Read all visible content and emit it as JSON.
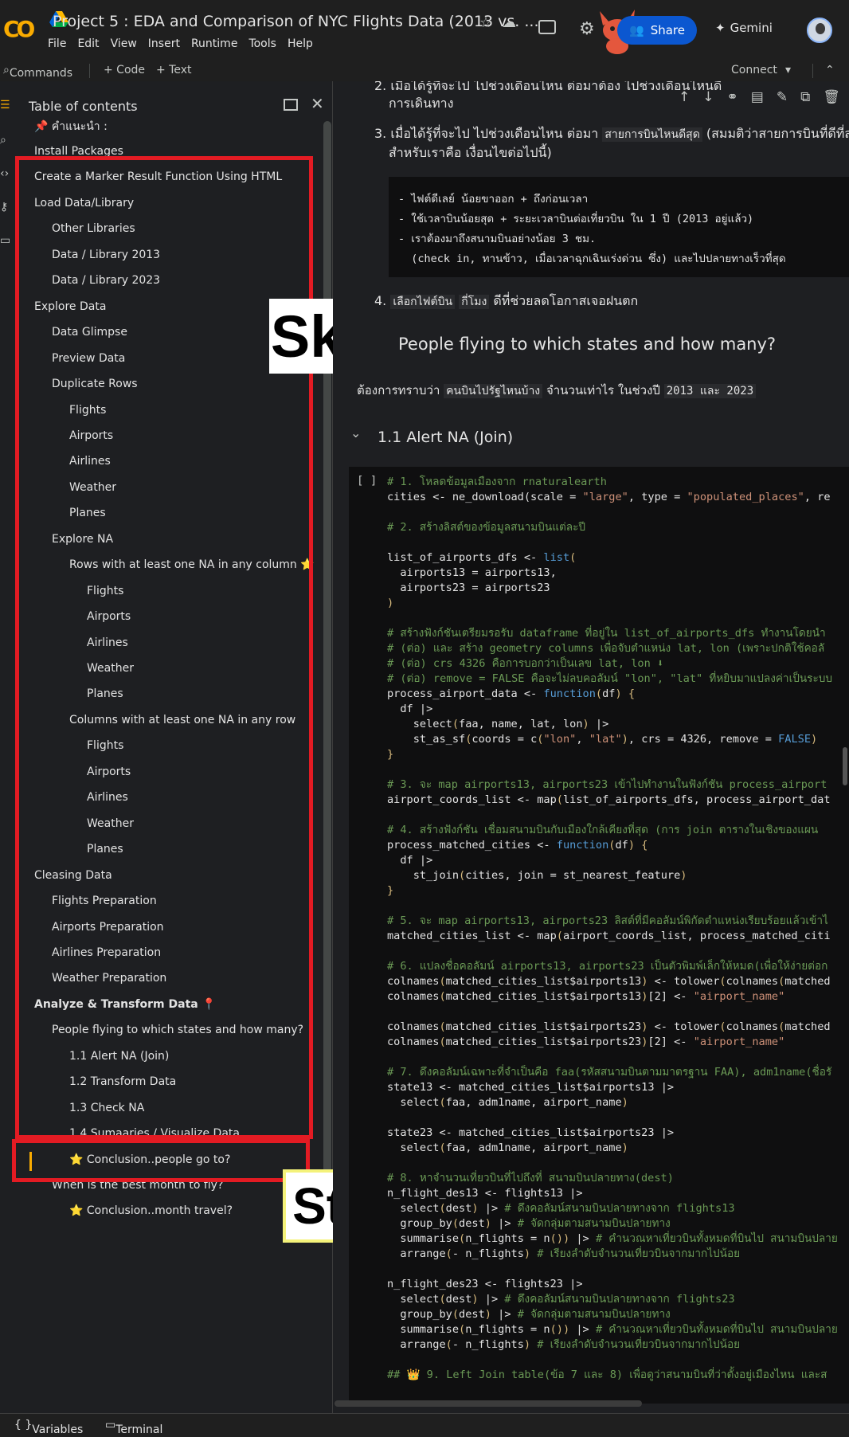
{
  "header": {
    "logo": "CO",
    "title": "Project 5 : EDA and Comparison of NYC Flights Data (2013 vs. ...",
    "menu": [
      "File",
      "Edit",
      "View",
      "Insert",
      "Runtime",
      "Tools",
      "Help"
    ],
    "share_label": "Share",
    "gemini_label": "Gemini"
  },
  "toolbar": {
    "commands_label": "Commands",
    "code_label": "+ Code",
    "text_label": "+ Text",
    "connect_label": "Connect"
  },
  "toc": {
    "title": "Table of contents",
    "note": "📌 คำแนะนำ :",
    "items": [
      {
        "label": "Install Packages",
        "level": 1
      },
      {
        "label": "Create a Marker Result Function Using HTML",
        "level": 1
      },
      {
        "label": "Load Data/Library",
        "level": 1
      },
      {
        "label": "Other Libraries",
        "level": 2
      },
      {
        "label": "Data / Library 2013",
        "level": 2
      },
      {
        "label": "Data / Library 2023",
        "level": 2
      },
      {
        "label": "Explore Data",
        "level": 1
      },
      {
        "label": "Data Glimpse",
        "level": 2
      },
      {
        "label": "Preview Data",
        "level": 2
      },
      {
        "label": "Duplicate Rows",
        "level": 2
      },
      {
        "label": "Flights",
        "level": 3
      },
      {
        "label": "Airports",
        "level": 3
      },
      {
        "label": "Airlines",
        "level": 3
      },
      {
        "label": "Weather",
        "level": 3
      },
      {
        "label": "Planes",
        "level": 3
      },
      {
        "label": "Explore NA",
        "level": 2
      },
      {
        "label": "Rows with at least one NA in any column ⭐",
        "level": 3
      },
      {
        "label": "Flights",
        "level": 4
      },
      {
        "label": "Airports",
        "level": 4
      },
      {
        "label": "Airlines",
        "level": 4
      },
      {
        "label": "Weather",
        "level": 4
      },
      {
        "label": "Planes",
        "level": 4
      },
      {
        "label": "Columns with at least one NA in any row",
        "level": 3
      },
      {
        "label": "Flights",
        "level": 4
      },
      {
        "label": "Airports",
        "level": 4
      },
      {
        "label": "Airlines",
        "level": 4
      },
      {
        "label": "Weather",
        "level": 4
      },
      {
        "label": "Planes",
        "level": 4
      },
      {
        "label": "Cleasing Data",
        "level": 1
      },
      {
        "label": "Flights Preparation",
        "level": 2
      },
      {
        "label": "Airports Preparation",
        "level": 2
      },
      {
        "label": "Airlines Preparation",
        "level": 2
      },
      {
        "label": "Weather Preparation",
        "level": 2
      },
      {
        "label": "Analyze & Transform Data 📍",
        "level": 1,
        "active": true
      },
      {
        "label": "People flying to which states and how many?",
        "level": 2
      },
      {
        "label": "1.1 Alert NA (Join)",
        "level": 3
      },
      {
        "label": "1.2 Transform Data",
        "level": 3
      },
      {
        "label": "1.3 Check NA",
        "level": 3
      },
      {
        "label": "1.4 Sumaaries / Visualize Data",
        "level": 3
      },
      {
        "label": "⭐ Conclusion..people go to?",
        "level": 3
      },
      {
        "label": "When is the best month to fly?",
        "level": 2
      },
      {
        "label": "⭐ Conclusion..month travel?",
        "level": 3
      }
    ],
    "skip_label": "Skip",
    "start_label": "Start"
  },
  "notebook": {
    "md_line_1": "2. เมื่อได้รู้ที่จะไป ไปช่วงเดือนไหน ต่อมาต้อง ไปช่วงเดือนไหนดี",
    "md_line_1b": "การเดินทาง",
    "md_line_2a": "3. เมื่อได้รู้ที่จะไป ไปช่วงเดือนไหน ต่อมา",
    "md_line_2_code": "สายการบินไหนดีสุด",
    "md_line_2b": "(สมมติว่าสายการบินที่ดีที่สุด",
    "md_line_2c": "สำหรับเราคือ เงื่อนไขต่อไปนี้)",
    "pre_text": "- ไฟต์ดีเลย์ น้อยขาออก + ถึงก่อนเวลา\n- ใช้เวลาบินน้อยสุด + ระยะเวลาบินต่อเที่ยวบิน ใน 1 ปี (2013 อยู่แล้ว)\n- เราต้องมาถึงสนามบินอย่างน้อย 3 ชม.\n  (check in, ทานข้าว, เมื่อเวลาฉุกเฉินเร่งด่วน ซึ่ง) และไปปลายทางเร็วที่สุด",
    "md_line_4a": "4.",
    "md_line_4_code": "เลือกไฟต์บิน",
    "md_line_4_code2": "กี่โมง",
    "md_line_4b": "ดีที่ช่วยลดโอกาสเจอฝนตก",
    "section_title": "People flying to which states and how many?",
    "section_sub_a": "ต้องการทราบว่า",
    "section_sub_code1": "คนบินไปรัฐไหนบ้าง",
    "section_sub_b": "จำนวนเท่าไร",
    "section_sub_c": "ในช่วงปี",
    "section_sub_code2": "2013 และ 2023",
    "subsection_title": "1.1 Alert NA (Join)",
    "run_bracket": "[ ]"
  },
  "bottom": {
    "variables_label": "Variables",
    "terminal_label": "Terminal"
  },
  "colors": {
    "accent": "#f9ab00",
    "share": "#0b57d0",
    "annotation_red": "#e31b23"
  }
}
